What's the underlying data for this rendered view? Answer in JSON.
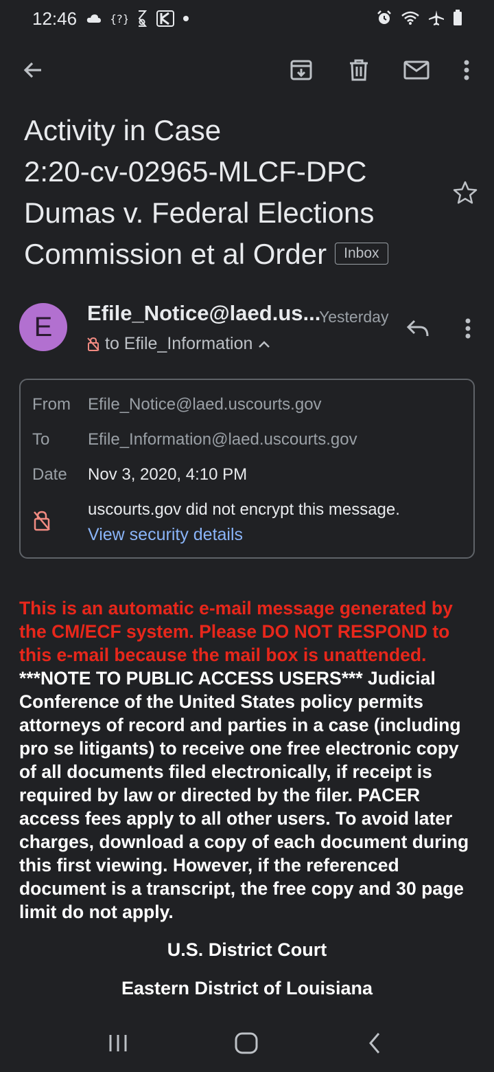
{
  "status_bar": {
    "time": "12:46",
    "left_icons": [
      "cloud-icon",
      "wifi-question-icon",
      "bluetooth-link-icon",
      "app-icon",
      "dot-icon"
    ],
    "right_icons": [
      "alarm-icon",
      "wifi-icon",
      "airplane-icon",
      "battery-icon"
    ]
  },
  "toolbar": {
    "icons": [
      "back-arrow-icon",
      "archive-icon",
      "delete-icon",
      "mark-unread-icon",
      "more-vert-icon"
    ]
  },
  "subject": {
    "lines": [
      "Activity in Case",
      "2:20-cv-02965-MLCF-DPC",
      "Dumas v. Federal Elections",
      "Commission et al Order"
    ],
    "label_chip": "Inbox"
  },
  "sender": {
    "avatar_letter": "E",
    "avatar_color": "#b270d0",
    "name": "Efile_Notice@laed.us...",
    "time": "Yesterday",
    "to_line": "to Efile_Information"
  },
  "details": {
    "from_label": "From",
    "from_value": "Efile_Notice@laed.uscourts.gov",
    "to_label": "To",
    "to_value": "Efile_Information@laed.uscourts.gov",
    "date_label": "Date",
    "date_value": "Nov 3, 2020, 4:10 PM",
    "security_text": "uscourts.gov did not encrypt this message.",
    "security_link": "View security details"
  },
  "body": {
    "warning": "This is an automatic e-mail message generated by the CM/ECF system. Please DO NOT RESPOND to this e-mail because the mail box is unattended.",
    "note": "***NOTE TO PUBLIC ACCESS USERS*** Judicial Conference of the United States policy permits attorneys of record and parties in a case (including pro se litigants) to receive one free electronic copy of all documents filed electronically, if receipt is required by law or directed by the filer. PACER access fees apply to all other users. To avoid later charges, download a copy of each document during this first viewing. However, if the referenced document is a transcript, the free copy and 30 page limit do not apply.",
    "court_line1": "U.S. District Court",
    "court_line2": "Eastern District of Louisiana"
  },
  "colors": {
    "background": "#202124",
    "warning_red": "#e8271b",
    "link_blue": "#8ab4f8"
  },
  "navbar": {
    "icons": [
      "recent-apps-icon",
      "home-icon",
      "back-icon"
    ]
  }
}
